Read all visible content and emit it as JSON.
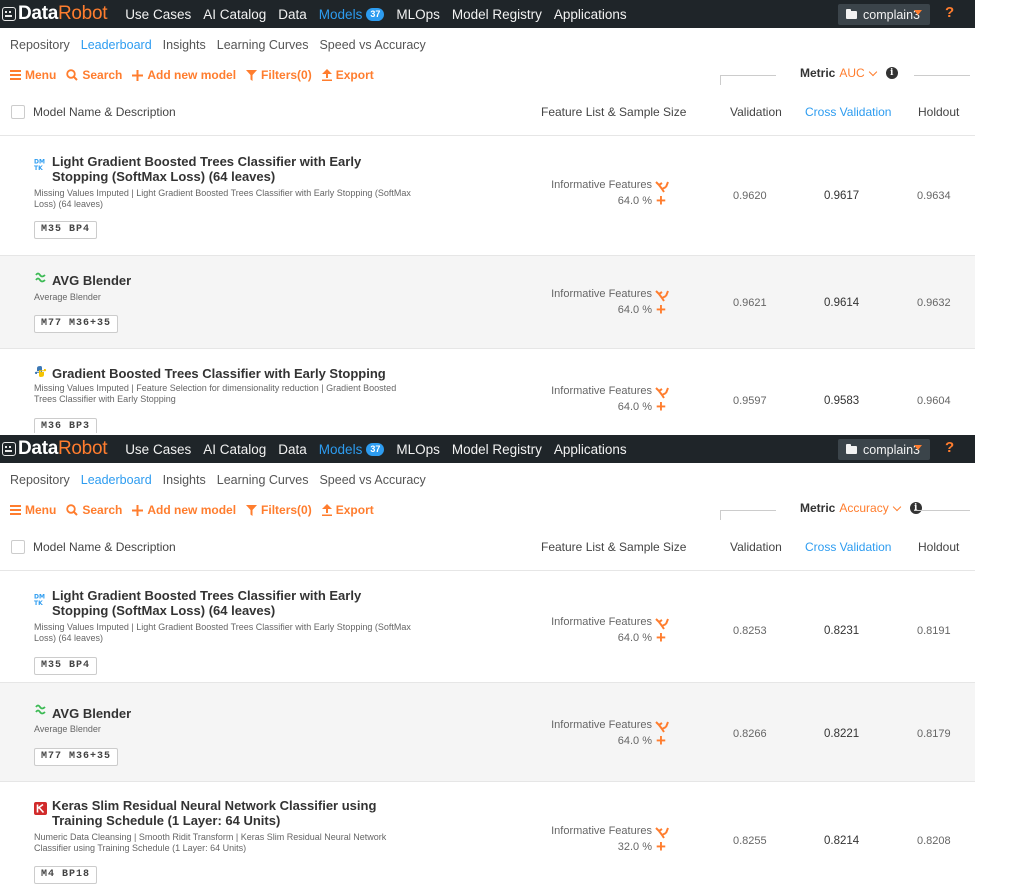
{
  "brand": {
    "data": "Data",
    "robot": "Robot"
  },
  "colors": {
    "accent": "#ff7d2e",
    "link": "#2d9cf0",
    "nav_bg": "#1f2529"
  },
  "panels": [
    {
      "nav": {
        "items": [
          "Use Cases",
          "AI Catalog",
          "Data",
          "Models",
          "MLOps",
          "Model Registry",
          "Applications"
        ],
        "models_badge": "37",
        "project": "complain3",
        "help": "?"
      },
      "subtabs": [
        "Repository",
        "Leaderboard",
        "Insights",
        "Learning Curves",
        "Speed vs Accuracy"
      ],
      "toolbar": {
        "menu": "Menu",
        "search": "Search",
        "add": "Add new model",
        "filters": "Filters(0)",
        "export": "Export"
      },
      "metric": {
        "label": "Metric",
        "value": "AUC"
      },
      "headers": {
        "model": "Model Name & Description",
        "feature": "Feature List & Sample Size",
        "validation": "Validation",
        "cv": "Cross Validation",
        "holdout": "Holdout"
      },
      "rows": [
        {
          "icon": "dmtk-icon",
          "title": "Light Gradient Boosted Trees Classifier with Early Stopping (SoftMax Loss) (64 leaves)",
          "desc": "Missing Values Imputed | Light Gradient Boosted Trees Classifier with Early Stopping (SoftMax Loss) (64 leaves)",
          "badge": "M35  BP4",
          "feature_list": "Informative Features",
          "sample": "64.0 %",
          "validation": "0.9620",
          "cv": "0.9617",
          "holdout": "0.9634"
        },
        {
          "icon": "blender-icon",
          "title": "AVG Blender",
          "desc": "Average Blender",
          "badge": "M77  M36+35",
          "feature_list": "Informative Features",
          "sample": "64.0 %",
          "validation": "0.9621",
          "cv": "0.9614",
          "holdout": "0.9632"
        },
        {
          "icon": "python-icon",
          "title": "Gradient Boosted Trees Classifier with Early Stopping",
          "desc": "Missing Values Imputed | Feature Selection for dimensionality reduction | Gradient Boosted Trees Classifier with Early Stopping",
          "badge": "M36  BP3",
          "feature_list": "Informative Features",
          "sample": "64.0 %",
          "validation": "0.9597",
          "cv": "0.9583",
          "holdout": "0.9604"
        }
      ]
    },
    {
      "nav": {
        "items": [
          "Use Cases",
          "AI Catalog",
          "Data",
          "Models",
          "MLOps",
          "Model Registry",
          "Applications"
        ],
        "models_badge": "37",
        "project": "complain3",
        "help": "?"
      },
      "subtabs": [
        "Repository",
        "Leaderboard",
        "Insights",
        "Learning Curves",
        "Speed vs Accuracy"
      ],
      "toolbar": {
        "menu": "Menu",
        "search": "Search",
        "add": "Add new model",
        "filters": "Filters(0)",
        "export": "Export"
      },
      "metric": {
        "label": "Metric",
        "value": "Accuracy"
      },
      "headers": {
        "model": "Model Name & Description",
        "feature": "Feature List & Sample Size",
        "validation": "Validation",
        "cv": "Cross Validation",
        "holdout": "Holdout"
      },
      "rows": [
        {
          "icon": "dmtk-icon",
          "title": "Light Gradient Boosted Trees Classifier with Early Stopping (SoftMax Loss) (64 leaves)",
          "desc": "Missing Values Imputed | Light Gradient Boosted Trees Classifier with Early Stopping (SoftMax Loss) (64 leaves)",
          "badge": "M35  BP4",
          "feature_list": "Informative Features",
          "sample": "64.0 %",
          "validation": "0.8253",
          "cv": "0.8231",
          "holdout": "0.8191"
        },
        {
          "icon": "blender-icon",
          "title": "AVG Blender",
          "desc": "Average Blender",
          "badge": "M77  M36+35",
          "feature_list": "Informative Features",
          "sample": "64.0 %",
          "validation": "0.8266",
          "cv": "0.8221",
          "holdout": "0.8179"
        },
        {
          "icon": "keras-icon",
          "title": "Keras Slim Residual Neural Network Classifier using Training Schedule (1 Layer: 64 Units)",
          "desc": "Numeric Data Cleansing | Smooth Ridit Transform | Keras Slim Residual Neural Network Classifier using Training Schedule (1 Layer: 64 Units)",
          "badge": "M4  BP18",
          "feature_list": "Informative Features",
          "sample": "32.0 %",
          "validation": "0.8255",
          "cv": "0.8214",
          "holdout": "0.8208"
        }
      ]
    }
  ]
}
